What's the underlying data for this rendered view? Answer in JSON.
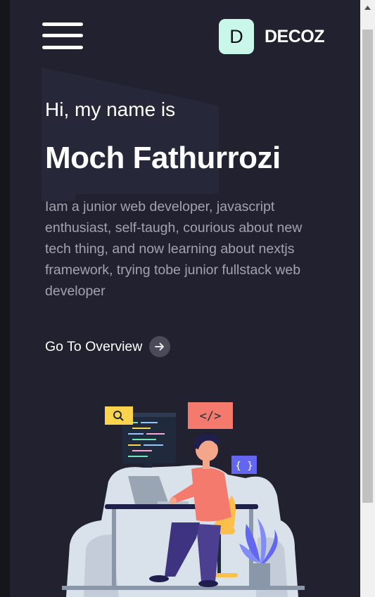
{
  "header": {
    "menu_icon": "hamburger-icon",
    "brand_initial": "D",
    "brand_name": "DECOZ"
  },
  "hero": {
    "greeting": "Hi, my name is",
    "name": "Moch Fathurrozi",
    "bio": "Iam a junior web developer, javascript enthusiast, self-taugh, courious about new tech thing, and now learning about nextjs framework, trying tobe junior fullstack web developer",
    "cta_label": "Go To Overview",
    "cta_icon": "arrow-right-icon"
  },
  "illustration": {
    "code_tag": "</>",
    "braces_tag": "{ }",
    "search_icon": "search-icon"
  },
  "colors": {
    "page_bg": "#212130",
    "brand_logo_bg": "#c9f7ea",
    "bio_text": "#a3a3b0",
    "code_badge": "#f47a6e",
    "braces_badge": "#6366f1",
    "search_badge": "#fcd34d"
  }
}
